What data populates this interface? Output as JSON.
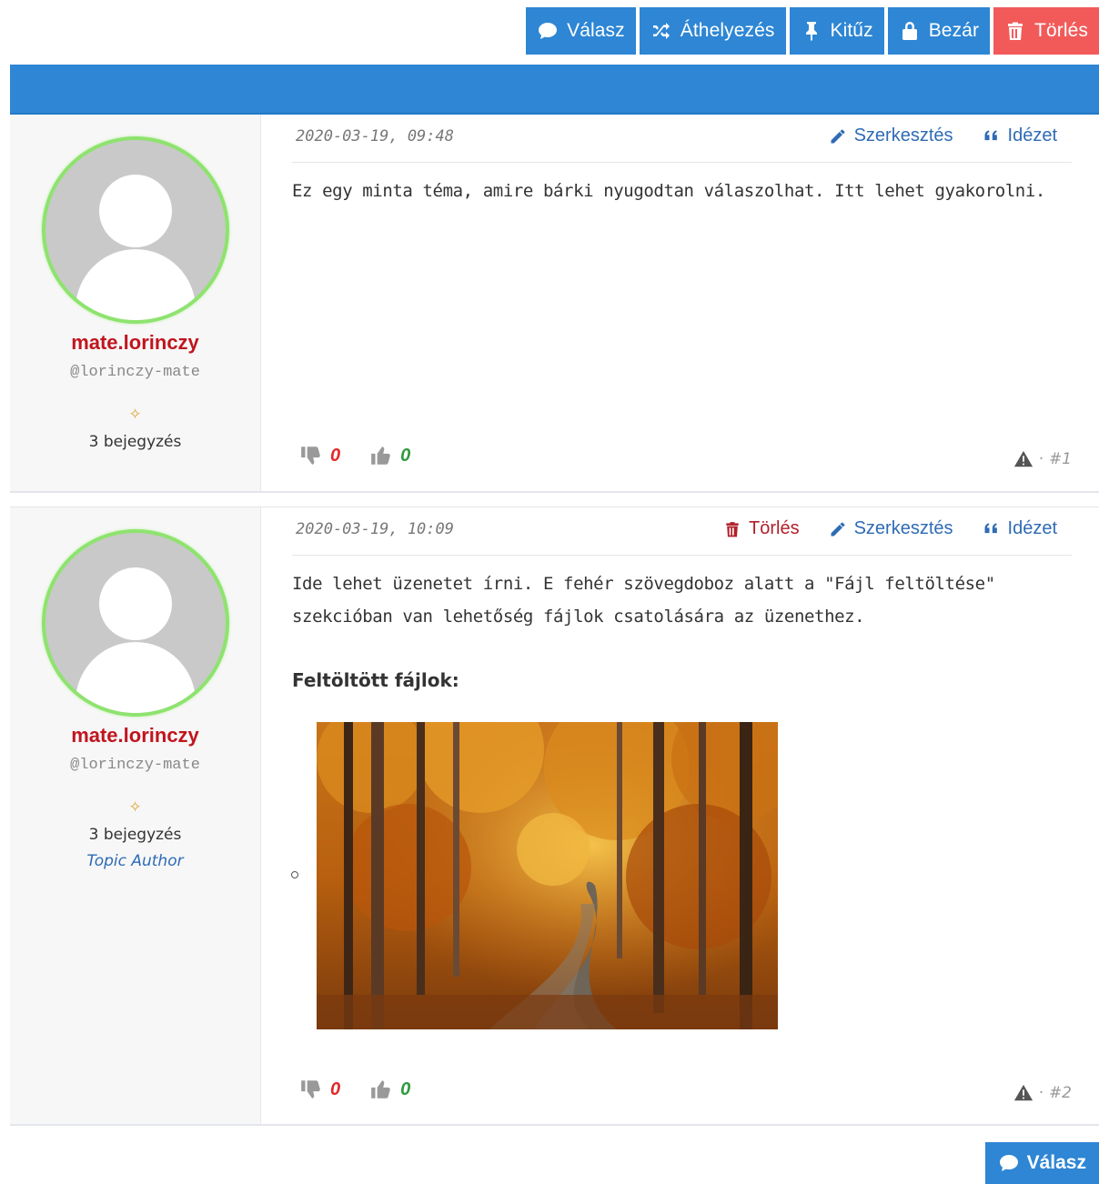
{
  "toolbar": {
    "reply": "Válasz",
    "move": "Áthelyezés",
    "pin": "Kitűz",
    "lock": "Bezár",
    "delete": "Törlés"
  },
  "posts": [
    {
      "author": {
        "name": "mate.lorinczy",
        "handle": "@lorinczy-mate",
        "post_count": "3 bejegyzés"
      },
      "date": "2020-03-19, 09:48",
      "actions": {
        "edit": "Szerkesztés",
        "quote": "Idézet"
      },
      "body": "Ez egy minta téma, amire bárki nyugodtan válaszolhat. Itt lehet gyakorolni.",
      "votes": {
        "down": "0",
        "up": "0"
      },
      "number": "#1",
      "number_sep": "·"
    },
    {
      "author": {
        "name": "mate.lorinczy",
        "handle": "@lorinczy-mate",
        "post_count": "3 bejegyzés",
        "role": "Topic Author"
      },
      "date": "2020-03-19, 10:09",
      "actions": {
        "delete": "Törlés",
        "edit": "Szerkesztés",
        "quote": "Idézet"
      },
      "body_lines": [
        "Ide lehet üzenetet írni. E fehér szövegdoboz alatt a \"Fájl feltöltése\"",
        "szekcióban van lehetőség fájlok csatolására az üzenethez."
      ],
      "files_title": "Feltöltött fájlok:",
      "votes": {
        "down": "0",
        "up": "0"
      },
      "number": "#2",
      "number_sep": "·"
    }
  ],
  "bottom": {
    "reply": "Válasz"
  },
  "colors": {
    "accent": "#2e86d4",
    "danger": "#f25a5a",
    "username": "#c0151e",
    "avatar_ring": "#8ee36f"
  }
}
